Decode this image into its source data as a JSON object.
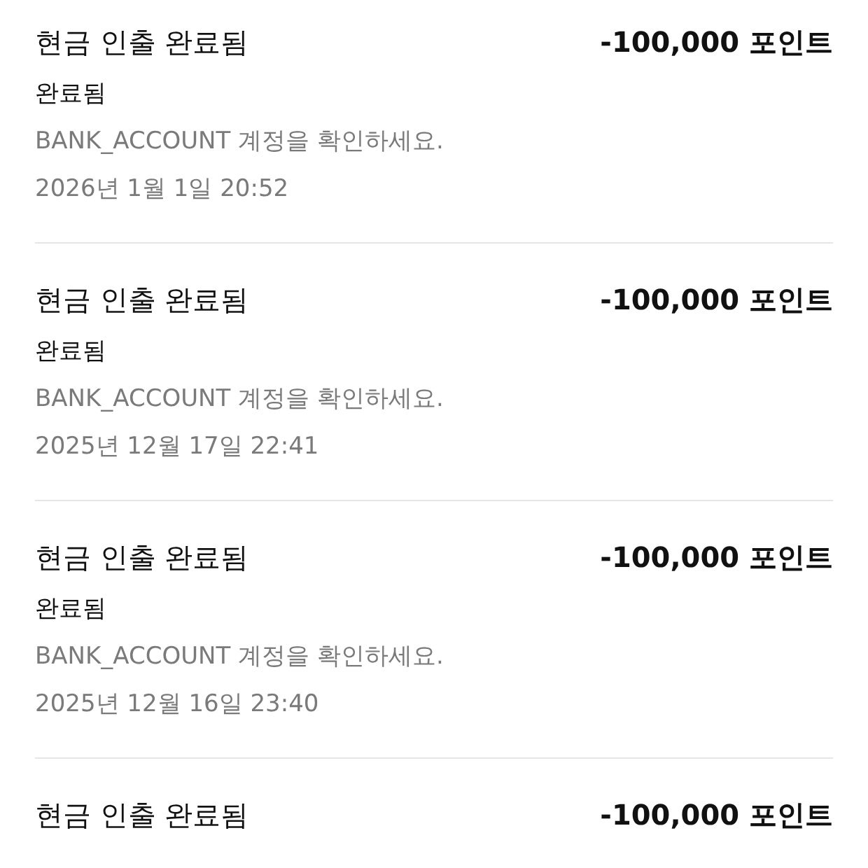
{
  "transactions": [
    {
      "title": "현금 인출 완료됨",
      "amount": "-100,000 포인트",
      "status": "완료됨",
      "note": "BANK_ACCOUNT 계정을 확인하세요.",
      "date": "2026년 1월 1일 20:52"
    },
    {
      "title": "현금 인출 완료됨",
      "amount": "-100,000 포인트",
      "status": "완료됨",
      "note": "BANK_ACCOUNT 계정을 확인하세요.",
      "date": "2025년 12월 17일 22:41"
    },
    {
      "title": "현금 인출 완료됨",
      "amount": "-100,000 포인트",
      "status": "완료됨",
      "note": "BANK_ACCOUNT 계정을 확인하세요.",
      "date": "2025년 12월 16일 23:40"
    },
    {
      "title": "현금 인출 완료됨",
      "amount": "-100,000 포인트"
    }
  ]
}
